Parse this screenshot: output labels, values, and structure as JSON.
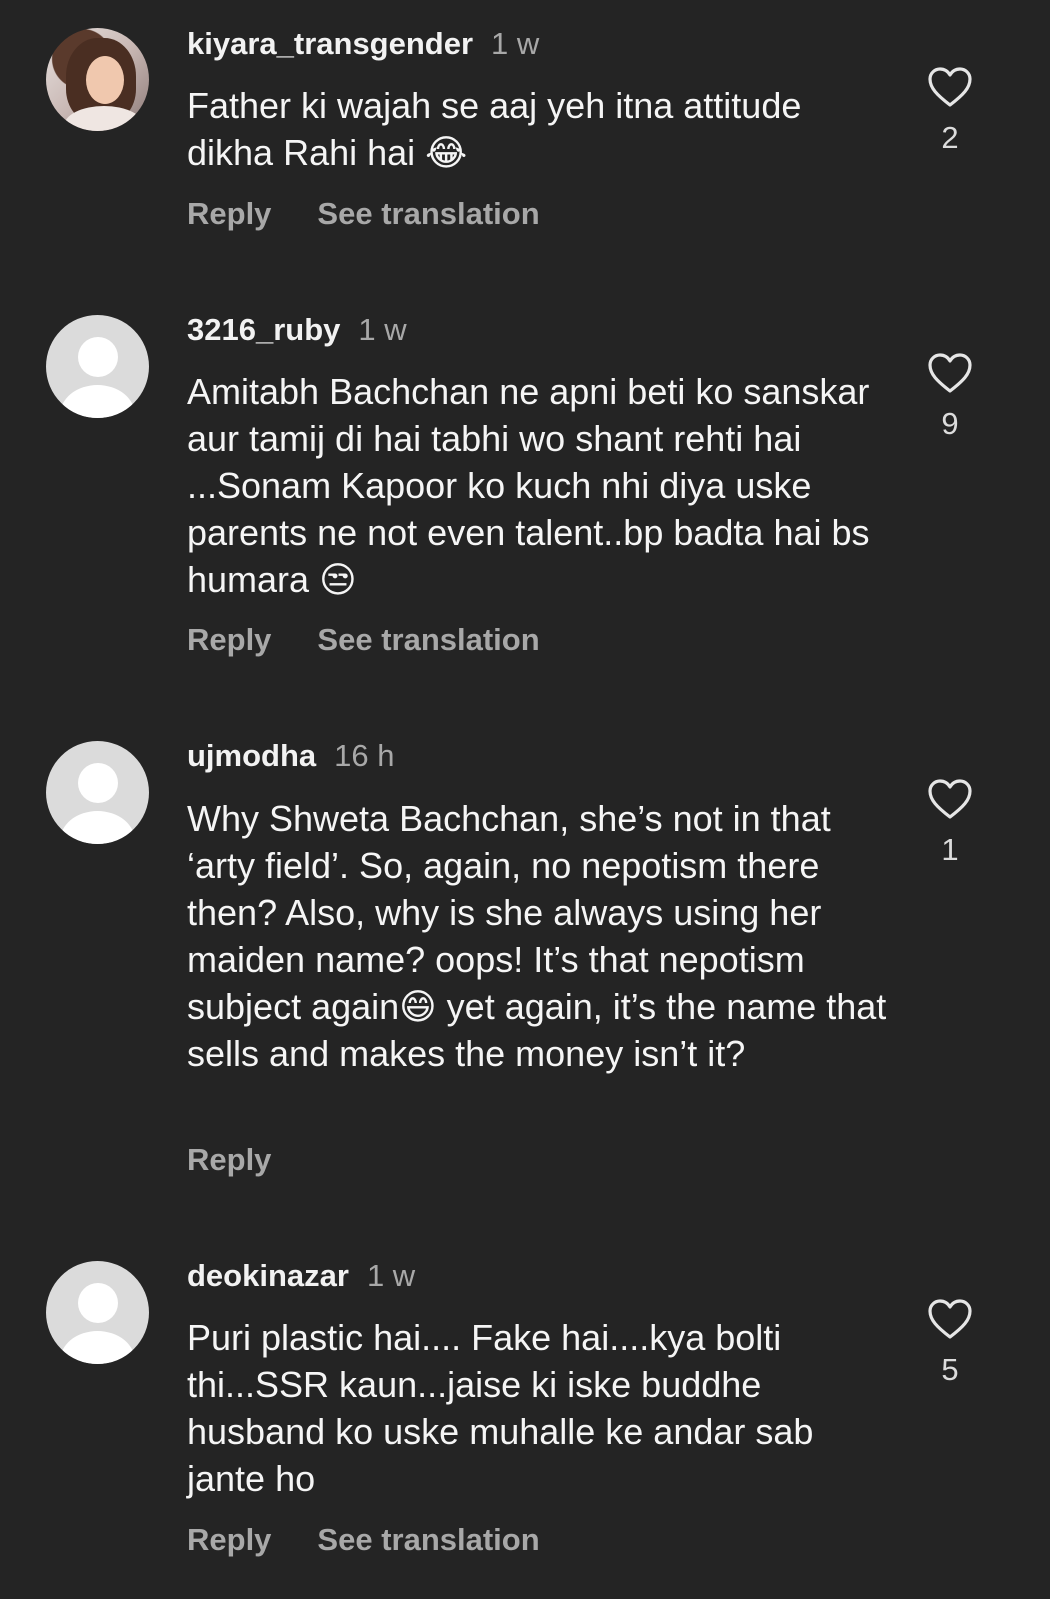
{
  "comments": [
    {
      "username": "kiyara_transgender",
      "time": "1 w",
      "text": "Father ki wajah se aaj yeh itna attitude dikha Rahi hai 😂",
      "likes": "2",
      "reply_label": "Reply",
      "translate_label": "See translation",
      "avatar": "user-photo"
    },
    {
      "username": "3216_ruby",
      "time": "1 w",
      "text": "Amitabh Bachchan ne apni beti ko sanskar aur tamij di hai tabhi wo shant rehti hai ...Sonam Kapoor ko kuch nhi diya uske parents ne not even talent..bp badta hai bs humara 😒",
      "likes": "9",
      "reply_label": "Reply",
      "translate_label": "See translation",
      "avatar": "default-avatar"
    },
    {
      "username": "ujmodha",
      "time": "16 h",
      "text": "Why Shweta Bachchan, she’s not in that ‘arty field’. So, again, no nepotism there then? Also, why is she always using her maiden name? oops! It’s that nepotism subject again😄 yet again, it’s the name that sells and makes the money isn’t it?",
      "likes": "1",
      "reply_label": "Reply",
      "avatar": "default-avatar"
    },
    {
      "username": "deokinazar",
      "time": "1 w",
      "text": "Puri plastic hai.... Fake hai....kya bolti thi...SSR kaun...jaise ki iske buddhe husband ko uske muhalle ke andar sab jante ho",
      "likes": "5",
      "reply_label": "Reply",
      "translate_label": "See translation",
      "avatar": "default-avatar"
    }
  ],
  "colors": {
    "background": "#242424",
    "primary_text": "#f5f5f5",
    "secondary_text": "#a8a8a8",
    "avatar_placeholder": "#dbdbdb"
  },
  "icons": {
    "like": "heart-outline-icon"
  }
}
